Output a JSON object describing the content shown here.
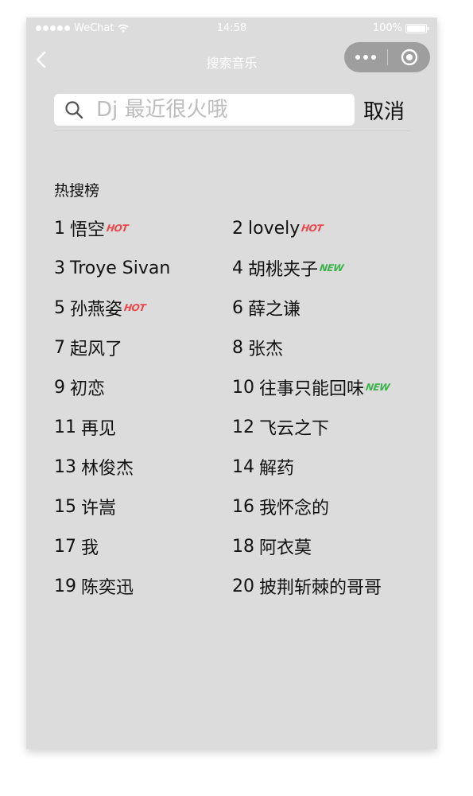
{
  "status_bar": {
    "carrier": "WeChat",
    "time": "14:58",
    "battery": "100%"
  },
  "nav": {
    "title": "搜索音乐"
  },
  "search": {
    "placeholder": "Dj 最近很火哦",
    "cancel_label": "取消"
  },
  "hot_list": {
    "title": "热搜榜",
    "items": [
      {
        "rank": "1",
        "name": "悟空",
        "tag": "HOT"
      },
      {
        "rank": "2",
        "name": "lovely",
        "tag": "HOT"
      },
      {
        "rank": "3",
        "name": "Troye Sivan",
        "tag": ""
      },
      {
        "rank": "4",
        "name": "胡桃夹子",
        "tag": "NEW"
      },
      {
        "rank": "5",
        "name": "孙燕姿",
        "tag": "HOT"
      },
      {
        "rank": "6",
        "name": "薛之谦",
        "tag": ""
      },
      {
        "rank": "7",
        "name": "起风了",
        "tag": ""
      },
      {
        "rank": "8",
        "name": "张杰",
        "tag": ""
      },
      {
        "rank": "9",
        "name": "初恋",
        "tag": ""
      },
      {
        "rank": "10",
        "name": "往事只能回味",
        "tag": "NEW"
      },
      {
        "rank": "11",
        "name": "再见",
        "tag": ""
      },
      {
        "rank": "12",
        "name": "飞云之下",
        "tag": ""
      },
      {
        "rank": "13",
        "name": "林俊杰",
        "tag": ""
      },
      {
        "rank": "14",
        "name": "解药",
        "tag": ""
      },
      {
        "rank": "15",
        "name": "许嵩",
        "tag": ""
      },
      {
        "rank": "16",
        "name": "我怀念的",
        "tag": ""
      },
      {
        "rank": "17",
        "name": "我",
        "tag": ""
      },
      {
        "rank": "18",
        "name": "阿衣莫",
        "tag": ""
      },
      {
        "rank": "19",
        "name": "陈奕迅",
        "tag": ""
      },
      {
        "rank": "20",
        "name": "披荆斩棘的哥哥",
        "tag": ""
      }
    ]
  },
  "colors": {
    "background": "#dcdcdc",
    "hot_tag": "#e8484c",
    "new_tag": "#3cb34a"
  }
}
